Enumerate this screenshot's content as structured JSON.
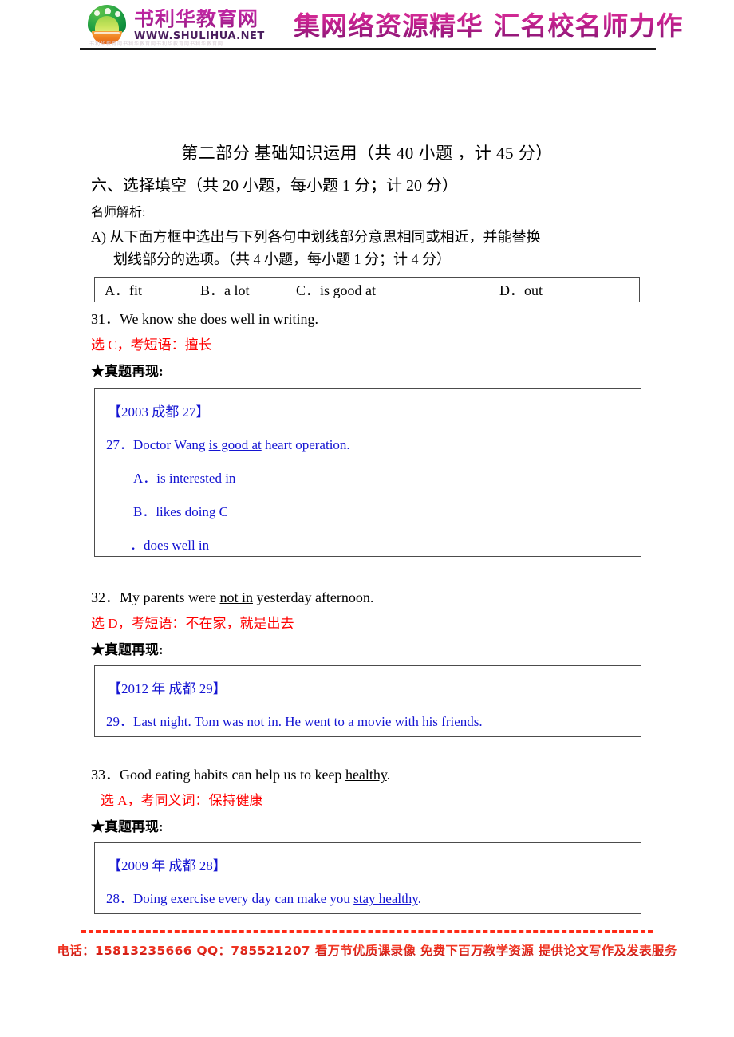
{
  "header": {
    "logo_cn": "书利华教育网",
    "logo_url": "WWW.SHULIHUA.NET",
    "logo_ghost": "书利华教育网书利华教育网书利华教育网书利华教育网",
    "slogan": "集网络资源精华  汇名校名师力作",
    "logo_emblem_icon": "shulihua-emblem-icon",
    "brand_color": "#b5219b",
    "emblem_green": "#11913e",
    "emblem_orange": "#ef7e20"
  },
  "document": {
    "title": "第二部分 基础知识运用（共 40 小题 ，计 45 分）",
    "section_heading": "六、选择填空（共 20 小题，每小题 1 分；计 20 分）",
    "analysis_label": "名师解析:",
    "part_a_line1": "A)  从下面方框中选出与下列各句中划线部分意思相同或相近，并能替换",
    "part_a_line2": "划线部分的选项。（共 4 小题，每小题 1 分；计 4 分）",
    "options_box": {
      "a": "A．fit",
      "b": "B．a lot",
      "c": "C．is good at",
      "d": "D．out"
    },
    "real_question_label": "★真题再现:",
    "answer_color": "#ff0000",
    "quote_color": "#1414d2"
  },
  "questions": [
    {
      "number": "31",
      "stem_pre": "31．We know she ",
      "stem_underlined": "does well in",
      "stem_post": " writing.",
      "answer": "选 C，考短语：擅长",
      "real_label": "★真题再现:",
      "box": {
        "source": "【2003  成都  27】",
        "q_pre": "27．Doctor Wang  ",
        "q_underlined": "is good at",
        "q_post": " heart operation.",
        "options": [
          "A．is interested in",
          "B．likes doing C",
          "．does well in"
        ]
      }
    },
    {
      "number": "32",
      "stem_pre": "32．My parents were ",
      "stem_underlined": "not in",
      "stem_post": " yesterday afternoon.",
      "answer": "选 D，考短语：不在家，就是出去",
      "real_label": "★真题再现:",
      "box": {
        "source": "【2012 年  成都  29】",
        "q_pre": "29．Last night. Tom was ",
        "q_underlined": "not in",
        "q_post": ". He went to a movie with his friends.",
        "options": []
      }
    },
    {
      "number": "33",
      "stem_pre": "33．Good eating habits can help us to keep ",
      "stem_underlined": "healthy",
      "stem_post": ".",
      "answer": "选 A，考同义词：保持健康",
      "real_label": "★真题再现:",
      "box": {
        "source": "【2009 年  成都  28】",
        "q_pre": "28．Doing exercise every day can make you ",
        "q_underlined": "stay healthy",
        "q_post": ".",
        "options": []
      }
    }
  ],
  "footer": {
    "text": "电话：15813235666 QQ：785521207 看万节优质课录像 免费下百万教学资源 提供论文写作及发表服务",
    "color": "#e03020"
  }
}
